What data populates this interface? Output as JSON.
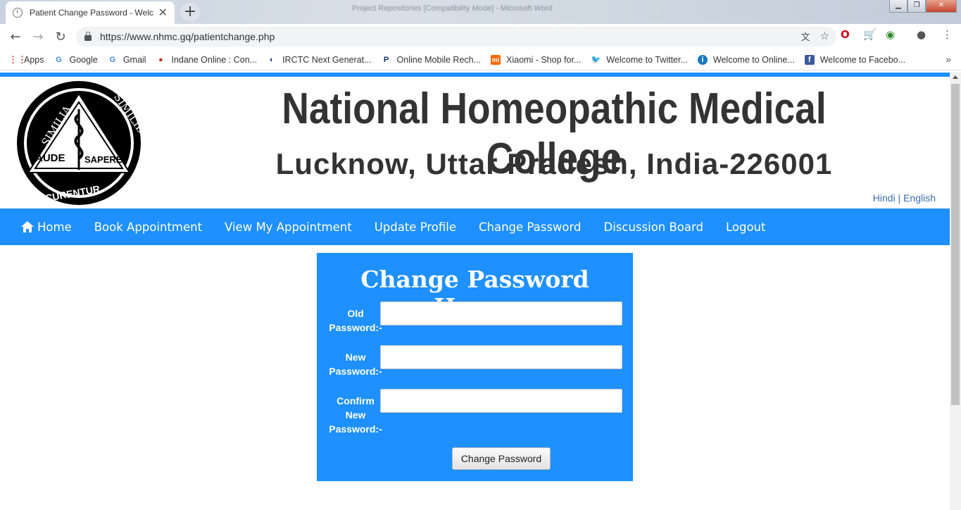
{
  "browser": {
    "tab_title": "Patient Change Password - Welc",
    "window_title": "Project Repositories [Compatibility Mode] - Microsoft Word",
    "url": "https://www.nhmc.gq/patientchange.php",
    "bookmarks": [
      {
        "label": "Apps",
        "icon": "apps-grid-icon"
      },
      {
        "label": "Google",
        "icon": "google-icon"
      },
      {
        "label": "Gmail",
        "icon": "google-icon"
      },
      {
        "label": "Indane Online : Con...",
        "icon": "indane-icon"
      },
      {
        "label": "IRCTC Next Generat...",
        "icon": "irctc-icon"
      },
      {
        "label": "Online Mobile Rech...",
        "icon": "paytm-icon"
      },
      {
        "label": "Xiaomi - Shop for...",
        "icon": "mi-icon"
      },
      {
        "label": "Welcome to Twitter...",
        "icon": "twitter-icon"
      },
      {
        "label": "Welcome to Online...",
        "icon": "sbi-icon"
      },
      {
        "label": "Welcome to Facebo...",
        "icon": "facebook-icon"
      }
    ]
  },
  "header": {
    "college_name": "National Homeopathic Medical College",
    "address": "Lucknow, Uttar Pradesh, India-226001",
    "lang_hindi": "Hindi",
    "lang_sep": "|",
    "lang_english": "English",
    "logo_text": {
      "top_left": "SIMILIA",
      "top_right": "SIMILIBUS",
      "mid_left": "AUDE",
      "mid_right": "SAPERE",
      "bottom": "CURENTUR"
    }
  },
  "nav": {
    "home": "Home",
    "book": "Book Appointment",
    "view": "View My Appointment",
    "update": "Update Profile",
    "change": "Change Password",
    "discussion": "Discussion Board",
    "logout": "Logout"
  },
  "form": {
    "title": "Change Password Here:-",
    "old_label_1": "Old",
    "old_label_2": "Password:-",
    "new_label_1": "New",
    "new_label_2": "Password:-",
    "confirm_label_1": "Confirm",
    "confirm_label_2": "New",
    "confirm_label_3": "Password:-",
    "old_value": "",
    "new_value": "",
    "confirm_value": "",
    "submit": "Change Password"
  },
  "colors": {
    "accent": "#1e90ff",
    "text_dark": "#333333",
    "link": "#3a6db0"
  }
}
